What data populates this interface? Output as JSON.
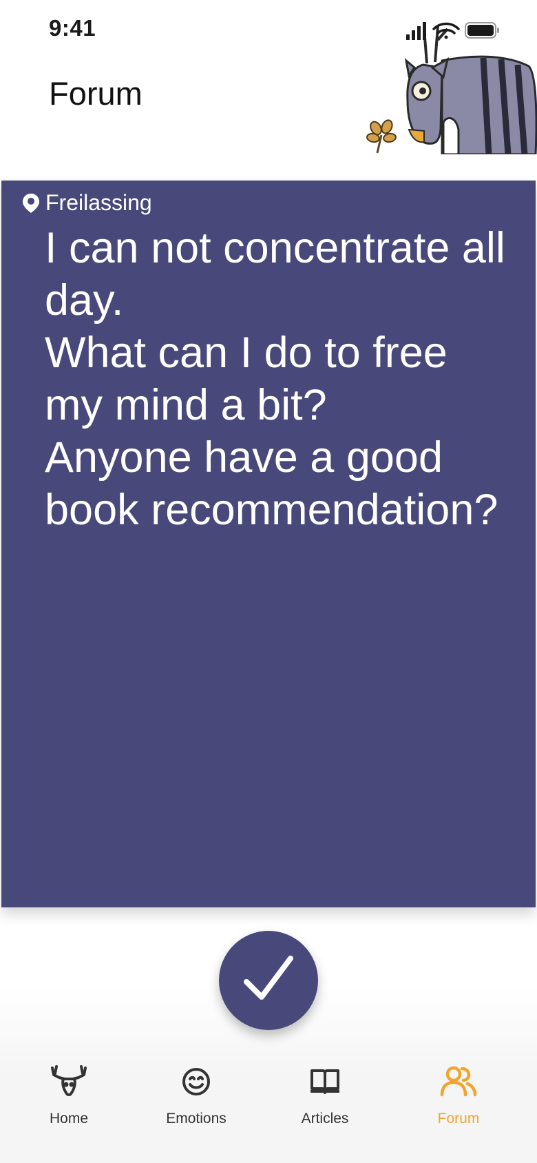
{
  "status_bar": {
    "time": "9:41"
  },
  "header": {
    "title": "Forum",
    "mascot_icon": "moose-mascot-icon"
  },
  "post": {
    "location": "Freilassing",
    "text": "I can not concentrate all day.\nWhat can I do to free my mind a bit?\nAnyone have a good book recommendation?",
    "background_color": "#48487a"
  },
  "confirm_button": {
    "icon": "checkmark-icon"
  },
  "bottom_nav": {
    "active_color": "#f0a52e",
    "items": [
      {
        "label": "Home",
        "icon": "moose-head-icon",
        "active": false
      },
      {
        "label": "Emotions",
        "icon": "smiley-icon",
        "active": false
      },
      {
        "label": "Articles",
        "icon": "open-book-icon",
        "active": false
      },
      {
        "label": "Forum",
        "icon": "people-icon",
        "active": true
      }
    ]
  }
}
